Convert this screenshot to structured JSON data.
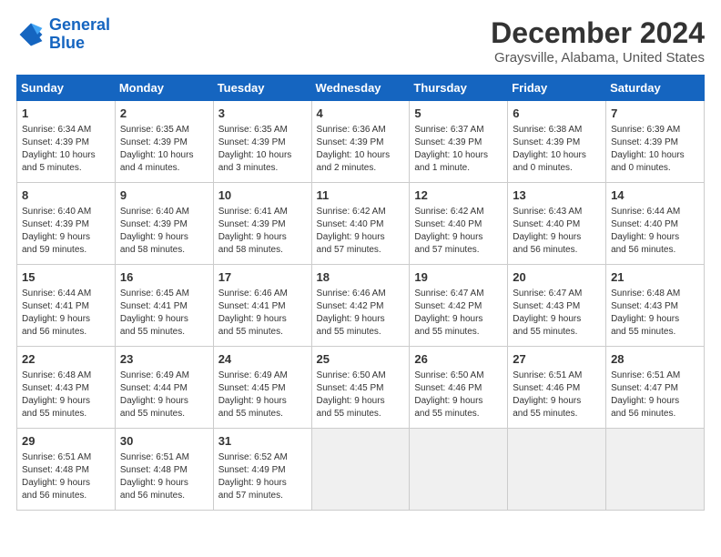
{
  "header": {
    "logo_line1": "General",
    "logo_line2": "Blue",
    "month": "December 2024",
    "location": "Graysville, Alabama, United States"
  },
  "weekdays": [
    "Sunday",
    "Monday",
    "Tuesday",
    "Wednesday",
    "Thursday",
    "Friday",
    "Saturday"
  ],
  "weeks": [
    [
      {
        "day": "1",
        "info": "Sunrise: 6:34 AM\nSunset: 4:39 PM\nDaylight: 10 hours\nand 5 minutes."
      },
      {
        "day": "2",
        "info": "Sunrise: 6:35 AM\nSunset: 4:39 PM\nDaylight: 10 hours\nand 4 minutes."
      },
      {
        "day": "3",
        "info": "Sunrise: 6:35 AM\nSunset: 4:39 PM\nDaylight: 10 hours\nand 3 minutes."
      },
      {
        "day": "4",
        "info": "Sunrise: 6:36 AM\nSunset: 4:39 PM\nDaylight: 10 hours\nand 2 minutes."
      },
      {
        "day": "5",
        "info": "Sunrise: 6:37 AM\nSunset: 4:39 PM\nDaylight: 10 hours\nand 1 minute."
      },
      {
        "day": "6",
        "info": "Sunrise: 6:38 AM\nSunset: 4:39 PM\nDaylight: 10 hours\nand 0 minutes."
      },
      {
        "day": "7",
        "info": "Sunrise: 6:39 AM\nSunset: 4:39 PM\nDaylight: 10 hours\nand 0 minutes."
      }
    ],
    [
      {
        "day": "8",
        "info": "Sunrise: 6:40 AM\nSunset: 4:39 PM\nDaylight: 9 hours\nand 59 minutes."
      },
      {
        "day": "9",
        "info": "Sunrise: 6:40 AM\nSunset: 4:39 PM\nDaylight: 9 hours\nand 58 minutes."
      },
      {
        "day": "10",
        "info": "Sunrise: 6:41 AM\nSunset: 4:39 PM\nDaylight: 9 hours\nand 58 minutes."
      },
      {
        "day": "11",
        "info": "Sunrise: 6:42 AM\nSunset: 4:40 PM\nDaylight: 9 hours\nand 57 minutes."
      },
      {
        "day": "12",
        "info": "Sunrise: 6:42 AM\nSunset: 4:40 PM\nDaylight: 9 hours\nand 57 minutes."
      },
      {
        "day": "13",
        "info": "Sunrise: 6:43 AM\nSunset: 4:40 PM\nDaylight: 9 hours\nand 56 minutes."
      },
      {
        "day": "14",
        "info": "Sunrise: 6:44 AM\nSunset: 4:40 PM\nDaylight: 9 hours\nand 56 minutes."
      }
    ],
    [
      {
        "day": "15",
        "info": "Sunrise: 6:44 AM\nSunset: 4:41 PM\nDaylight: 9 hours\nand 56 minutes."
      },
      {
        "day": "16",
        "info": "Sunrise: 6:45 AM\nSunset: 4:41 PM\nDaylight: 9 hours\nand 55 minutes."
      },
      {
        "day": "17",
        "info": "Sunrise: 6:46 AM\nSunset: 4:41 PM\nDaylight: 9 hours\nand 55 minutes."
      },
      {
        "day": "18",
        "info": "Sunrise: 6:46 AM\nSunset: 4:42 PM\nDaylight: 9 hours\nand 55 minutes."
      },
      {
        "day": "19",
        "info": "Sunrise: 6:47 AM\nSunset: 4:42 PM\nDaylight: 9 hours\nand 55 minutes."
      },
      {
        "day": "20",
        "info": "Sunrise: 6:47 AM\nSunset: 4:43 PM\nDaylight: 9 hours\nand 55 minutes."
      },
      {
        "day": "21",
        "info": "Sunrise: 6:48 AM\nSunset: 4:43 PM\nDaylight: 9 hours\nand 55 minutes."
      }
    ],
    [
      {
        "day": "22",
        "info": "Sunrise: 6:48 AM\nSunset: 4:43 PM\nDaylight: 9 hours\nand 55 minutes."
      },
      {
        "day": "23",
        "info": "Sunrise: 6:49 AM\nSunset: 4:44 PM\nDaylight: 9 hours\nand 55 minutes."
      },
      {
        "day": "24",
        "info": "Sunrise: 6:49 AM\nSunset: 4:45 PM\nDaylight: 9 hours\nand 55 minutes."
      },
      {
        "day": "25",
        "info": "Sunrise: 6:50 AM\nSunset: 4:45 PM\nDaylight: 9 hours\nand 55 minutes."
      },
      {
        "day": "26",
        "info": "Sunrise: 6:50 AM\nSunset: 4:46 PM\nDaylight: 9 hours\nand 55 minutes."
      },
      {
        "day": "27",
        "info": "Sunrise: 6:51 AM\nSunset: 4:46 PM\nDaylight: 9 hours\nand 55 minutes."
      },
      {
        "day": "28",
        "info": "Sunrise: 6:51 AM\nSunset: 4:47 PM\nDaylight: 9 hours\nand 56 minutes."
      }
    ],
    [
      {
        "day": "29",
        "info": "Sunrise: 6:51 AM\nSunset: 4:48 PM\nDaylight: 9 hours\nand 56 minutes."
      },
      {
        "day": "30",
        "info": "Sunrise: 6:51 AM\nSunset: 4:48 PM\nDaylight: 9 hours\nand 56 minutes."
      },
      {
        "day": "31",
        "info": "Sunrise: 6:52 AM\nSunset: 4:49 PM\nDaylight: 9 hours\nand 57 minutes."
      },
      {
        "day": "",
        "info": ""
      },
      {
        "day": "",
        "info": ""
      },
      {
        "day": "",
        "info": ""
      },
      {
        "day": "",
        "info": ""
      }
    ]
  ]
}
